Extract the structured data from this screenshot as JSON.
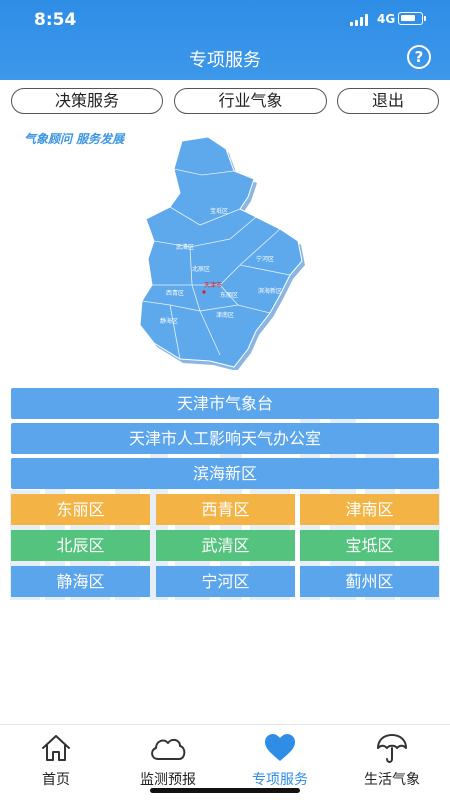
{
  "status": {
    "time": "8:54",
    "network": "4G"
  },
  "header": {
    "title": "专项服务",
    "help_icon": "question-circle-icon",
    "help_glyph": "?"
  },
  "top_buttons": [
    {
      "label": "决策服务"
    },
    {
      "label": "行业气象"
    },
    {
      "label": "退出"
    }
  ],
  "slogan": "气象顾问 服务发展",
  "map": {
    "districts": [
      "蓟州区",
      "宝坻区",
      "武清区",
      "宁河区",
      "北辰区",
      "天津市",
      "西青区",
      "东丽区",
      "滨海新区",
      "静海区",
      "津南区"
    ]
  },
  "wide_buttons": [
    {
      "label": "天津市气象台"
    },
    {
      "label": "天津市人工影响天气办公室"
    },
    {
      "label": "滨海新区"
    }
  ],
  "grid_buttons": [
    {
      "label": "东丽区"
    },
    {
      "label": "西青区"
    },
    {
      "label": "津南区"
    },
    {
      "label": "北辰区"
    },
    {
      "label": "武清区"
    },
    {
      "label": "宝坻区"
    },
    {
      "label": "静海区"
    },
    {
      "label": "宁河区"
    },
    {
      "label": "蓟州区"
    }
  ],
  "colors": {
    "header": "#2f8de6",
    "wide_button": "#5aa5ec",
    "orange": "#f3b445",
    "green": "#53c37e",
    "map_fill": "#5ea8ec",
    "active_nav": "#2f8de6"
  },
  "bottom_nav": [
    {
      "label": "首页",
      "icon": "home-icon"
    },
    {
      "label": "监测预报",
      "icon": "cloud-icon"
    },
    {
      "label": "专项服务",
      "icon": "heart-icon"
    },
    {
      "label": "生活气象",
      "icon": "umbrella-icon"
    }
  ]
}
